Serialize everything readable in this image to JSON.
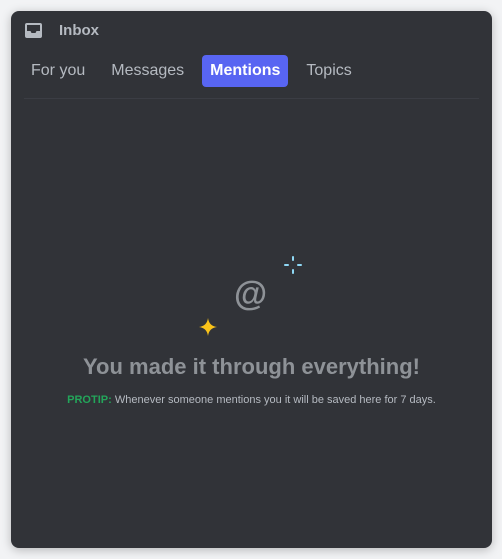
{
  "header": {
    "title": "Inbox",
    "icon": "inbox-icon"
  },
  "tabs": [
    {
      "label": "For you",
      "active": false
    },
    {
      "label": "Messages",
      "active": false
    },
    {
      "label": "Mentions",
      "active": true
    },
    {
      "label": "Topics",
      "active": false
    }
  ],
  "empty_state": {
    "symbol": "@",
    "headline": "You made it through everything!",
    "protip_label": "PROTIP:",
    "protip_text": " Whenever someone mentions you it will be saved here for 7 days."
  },
  "colors": {
    "panel_bg": "#313338",
    "accent": "#5865f2",
    "protip": "#23a55a",
    "sparkle_blue": "#8fd8f5",
    "sparkle_yellow": "#f9c31a"
  }
}
